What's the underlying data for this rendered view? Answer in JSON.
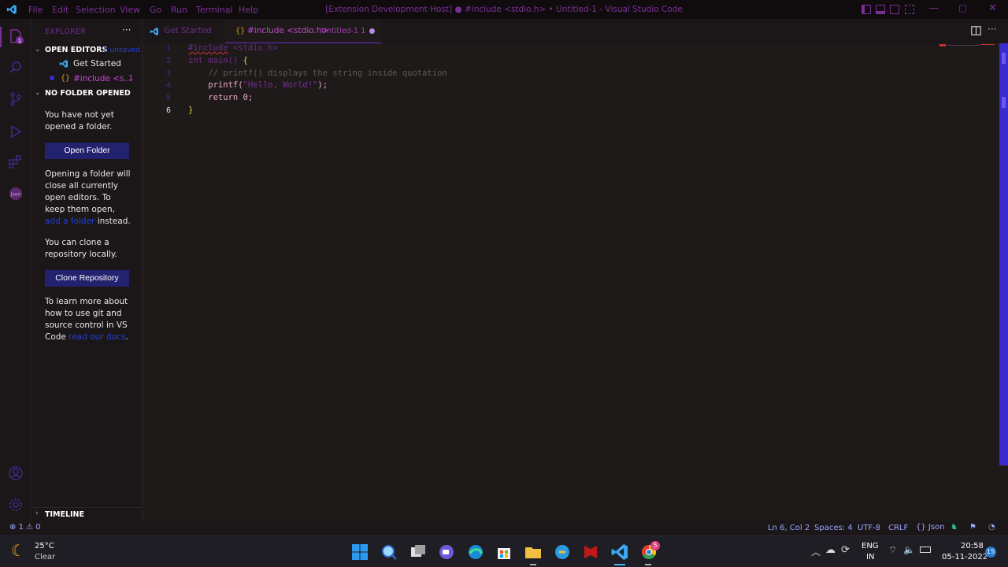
{
  "titlebar": {
    "menu": [
      "File",
      "Edit",
      "Selection",
      "View",
      "Go",
      "Run",
      "Terminal",
      "Help"
    ],
    "window_title": "[Extension Development Host] ● #include <stdio.h> • Untitled-1 - Visual Studio Code"
  },
  "explorer": {
    "header": "EXPLORER",
    "more": "···",
    "open_editors": {
      "title": "OPEN EDITORS",
      "badge": "1 unsaved",
      "items": [
        {
          "name": "Get Started"
        },
        {
          "name": "#include <s...",
          "count": "1"
        }
      ]
    },
    "no_folder": {
      "title": "NO FOLDER OPENED",
      "msg1": "You have not yet opened a folder.",
      "open_folder": "Open Folder",
      "msg2_a": "Opening a folder will close all currently open editors. To keep them open,",
      "msg2_link": "add a folder",
      "msg2_b": "instead.",
      "msg3": "You can clone a repository locally.",
      "clone": "Clone Repository",
      "msg4_a": "To learn more about how to use git and source control in VS Code",
      "msg4_link": "read our docs",
      "msg4_b": "."
    },
    "timeline": "TIMELINE"
  },
  "tabs": [
    {
      "label": "Get Started"
    },
    {
      "label": "#include <stdio.h>",
      "sub": "Untitled-1 1",
      "icon": "{}"
    }
  ],
  "code": {
    "lines": [
      "1",
      "2",
      "3",
      "4",
      "5",
      "6"
    ],
    "l1a": "#include",
    "l1b": " <stdio.h>",
    "l2a": "int",
    "l2b": " main() ",
    "l2c": "{",
    "l3": "    // printf() displays the string inside quotation",
    "l4a": "    printf(",
    "l4b": "\"Hello, World!\"",
    "l4c": ");",
    "l5a": "    return ",
    "l5b": "0",
    "l5c": ";",
    "l6": "}"
  },
  "status": {
    "errors": "1",
    "warnings": "0",
    "position": "Ln 6, Col 2",
    "spaces": "Spaces: 4",
    "encoding": "UTF-8",
    "eol": "CRLF",
    "language": "Json"
  },
  "taskbar": {
    "temp": "25°C",
    "weather": "Clear",
    "lang1": "ENG",
    "lang2": "IN",
    "time": "20:58",
    "date": "05-11-2022",
    "notif": "15",
    "chrome_badge": "5"
  },
  "colors": {
    "accent": "#7a2f97",
    "button": "#23226e",
    "link": "#2340d8",
    "scrollbar": "#3a2bd0"
  }
}
